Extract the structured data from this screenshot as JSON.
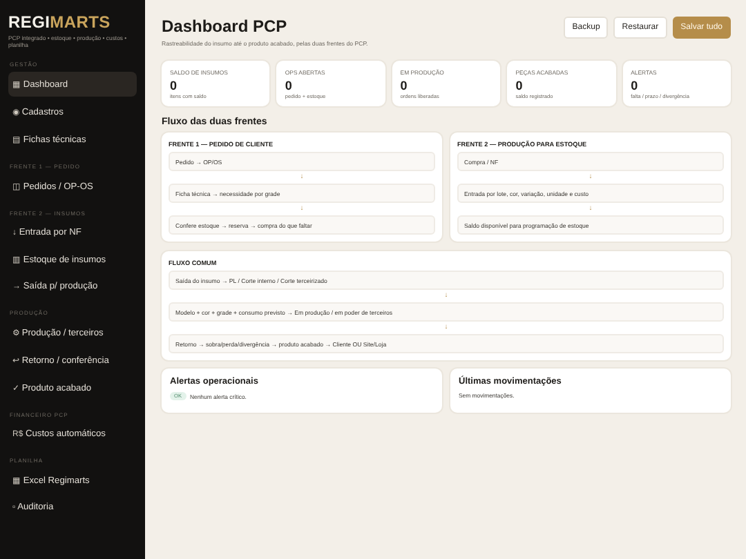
{
  "brand": {
    "part1": "REGI",
    "part2": "MARTS",
    "tagline": "PCP integrado • estoque • produção • custos • planilha"
  },
  "sidebar": [
    {
      "section": "GESTÃO",
      "items": [
        {
          "icon": "▦",
          "label": "Dashboard",
          "selected": true
        },
        {
          "icon": "◉",
          "label": "Cadastros",
          "selected": false
        },
        {
          "icon": "▤",
          "label": "Fichas técnicas",
          "selected": false
        }
      ]
    },
    {
      "section": "FRENTE 1 — PEDIDO",
      "items": [
        {
          "icon": "◫",
          "label": "Pedidos / OP-OS",
          "selected": false
        }
      ]
    },
    {
      "section": "FRENTE 2 — INSUMOS",
      "items": [
        {
          "icon": "↓",
          "label": "Entrada por NF",
          "selected": false
        },
        {
          "icon": "▥",
          "label": "Estoque de insumos",
          "selected": false
        },
        {
          "icon": "→",
          "label": "Saída p/ produção",
          "selected": false
        }
      ]
    },
    {
      "section": "PRODUÇÃO",
      "items": [
        {
          "icon": "⚙",
          "label": "Produção / terceiros",
          "selected": false
        },
        {
          "icon": "↩",
          "label": "Retorno / conferência",
          "selected": false
        },
        {
          "icon": "✓",
          "label": "Produto acabado",
          "selected": false
        }
      ]
    },
    {
      "section": "FINANCEIRO PCP",
      "items": [
        {
          "icon": "R$",
          "label": "Custos automáticos",
          "selected": false
        }
      ]
    },
    {
      "section": "PLANILHA",
      "items": [
        {
          "icon": "▦",
          "label": "Excel Regimarts",
          "selected": false
        },
        {
          "icon": "▫",
          "label": "Auditoria",
          "selected": false
        }
      ]
    }
  ],
  "header": {
    "title": "Dashboard PCP",
    "subtitle": "Rastreabilidade do insumo até o produto acabado, pelas duas frentes do PCP.",
    "buttons": [
      {
        "label": "Backup",
        "kind": "plain"
      },
      {
        "label": "Restaurar",
        "kind": "plain"
      },
      {
        "label": "Salvar tudo",
        "kind": "primary"
      }
    ]
  },
  "stats": [
    {
      "label": "SALDO DE INSUMOS",
      "value": "0",
      "note": "itens com saldo"
    },
    {
      "label": "OPS ABERTAS",
      "value": "0",
      "note": "pedido + estoque"
    },
    {
      "label": "EM PRODUÇÃO",
      "value": "0",
      "note": "ordens liberadas"
    },
    {
      "label": "PEÇAS ACABADAS",
      "value": "0",
      "note": "saldo registrado"
    },
    {
      "label": "ALERTAS",
      "value": "0",
      "note": "falta / prazo / divergência"
    }
  ],
  "flow_title": "Fluxo das duas frentes",
  "fronts": [
    {
      "title": "FRENTE 1 — PEDIDO DE CLIENTE",
      "steps": [
        "Pedido → OP/OS",
        "Ficha técnica → necessidade por grade",
        "Confere estoque → reserva → compra do que faltar"
      ],
      "arrows": [
        "↓",
        "↓"
      ]
    },
    {
      "title": "FRENTE 2 — PRODUÇÃO PARA ESTOQUE",
      "steps": [
        "Compra / NF",
        "Entrada por lote, cor, variação, unidade e custo",
        "Saldo disponível para programação de estoque"
      ],
      "arrows": [
        "↓",
        "↓"
      ]
    }
  ],
  "common_flow": {
    "title": "FLUXO COMUM",
    "steps": [
      "Saída do insumo → PL / Corte interno / Corte terceirizado",
      "Modelo + cor + grade + consumo previsto → Em produção / em poder de terceiros",
      "Retorno → sobra/perda/divergência → produto acabado → Cliente OU Site/Loja"
    ],
    "arrows": [
      "↓",
      "↓"
    ]
  },
  "alerts": {
    "title": "Alertas operacionais",
    "badge": "OK",
    "message": "Nenhum alerta crítico."
  },
  "movements": {
    "title": "Últimas movimentações",
    "message": "Sem movimentações."
  }
}
